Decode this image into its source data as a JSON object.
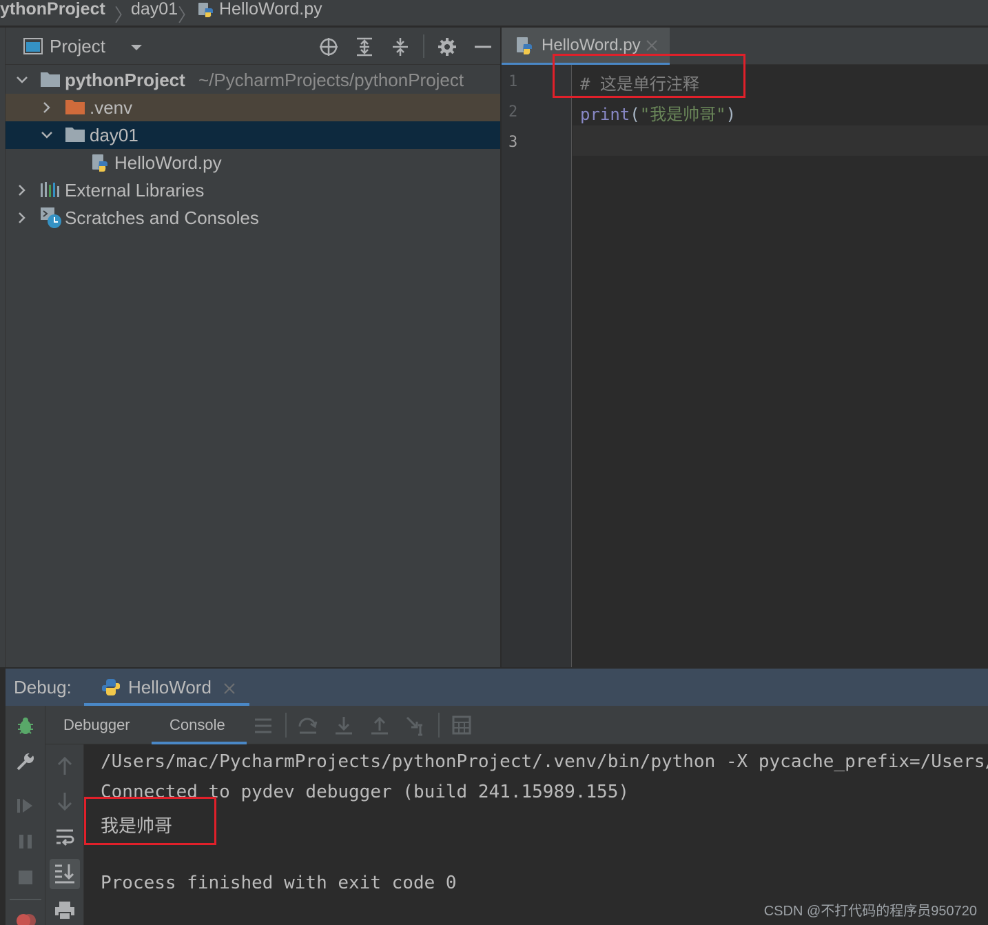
{
  "breadcrumb": {
    "items": [
      "ythonProject",
      "day01",
      "HelloWord.py"
    ]
  },
  "project_panel": {
    "title": "Project",
    "tree": [
      {
        "label": "pythonProject",
        "path": "~/PycharmProjects/pythonProject",
        "icon": "folder-icon",
        "expanded": true
      },
      {
        "label": ".venv",
        "icon": "folder-orange-icon",
        "expanded": false
      },
      {
        "label": "day01",
        "icon": "folder-icon",
        "expanded": true,
        "selected": true
      },
      {
        "label": "HelloWord.py",
        "icon": "python-file-icon"
      },
      {
        "label": "External Libraries",
        "icon": "libraries-icon",
        "expanded": false
      },
      {
        "label": "Scratches and Consoles",
        "icon": "scratches-icon",
        "expanded": false
      }
    ]
  },
  "editor": {
    "tab_label": "HelloWord.py",
    "line_numbers": [
      "1",
      "2",
      "3"
    ],
    "lines": {
      "comment": "# 这是单行注释",
      "print_kw": "print",
      "paren_open": "(",
      "string": "\"我是帅哥\"",
      "paren_close": ")"
    }
  },
  "debug": {
    "label": "Debug:",
    "run_tab": "HelloWord",
    "tabs": [
      "Debugger",
      "Console"
    ],
    "active_tab": "Console",
    "console_lines": [
      "/Users/mac/PycharmProjects/pythonProject/.venv/bin/python -X pycache_prefix=/Users/",
      "Connected to pydev debugger (build 241.15989.155)",
      "我是帅哥",
      "",
      "Process finished with exit code 0"
    ]
  },
  "watermark": "CSDN @不打代码的程序员950720",
  "colors": {
    "accent": "#4a88c7",
    "highlight_box": "#e0202a",
    "selection": "#0d293e",
    "venv_row": "#4b443a",
    "comment": "#808080",
    "keyword": "#8888c6",
    "string": "#6a8759"
  }
}
